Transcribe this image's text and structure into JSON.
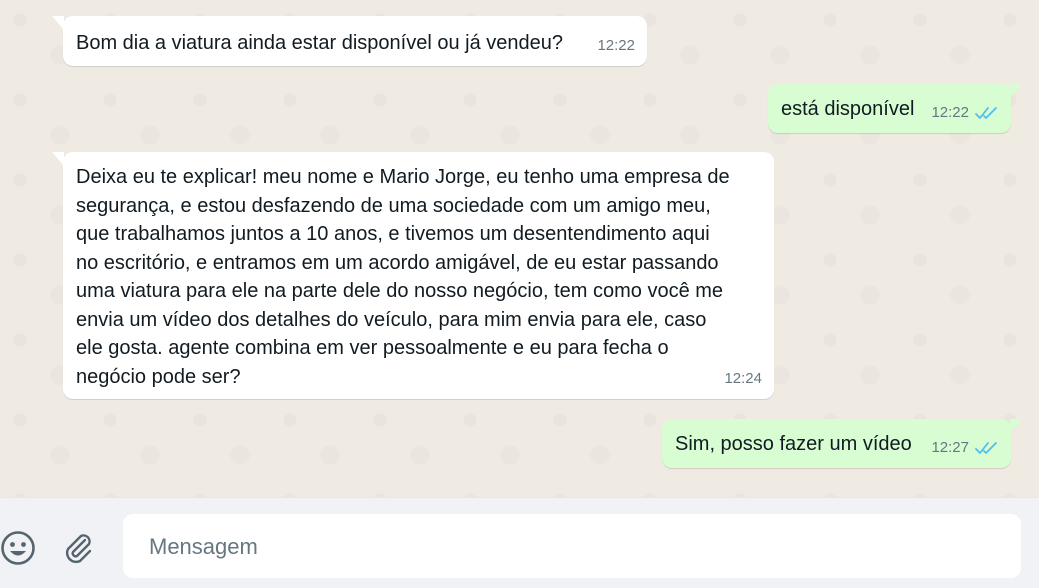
{
  "messages": [
    {
      "direction": "incoming",
      "text": "Bom dia a viatura ainda estar disponível ou já vendeu?",
      "time": "12:22"
    },
    {
      "direction": "outgoing",
      "text": "está disponível",
      "time": "12:22",
      "status": "read"
    },
    {
      "direction": "incoming",
      "text": "Deixa eu te explicar! meu nome e Mario Jorge, eu tenho uma empresa de\nsegurança, e estou desfazendo de uma sociedade com um amigo meu,\nque trabalhamos juntos a 10 anos, e tivemos um desentendimento aqui\nno escritório, e entramos em um acordo amigável, de eu estar passando\numa viatura para ele na parte dele do nosso negócio, tem como você me\nenvia um vídeo dos detalhes do veículo, para mim envia para ele, caso\nele gosta. agente combina em ver pessoalmente e eu para fecha o\nnegócio pode ser?",
      "time": "12:24"
    },
    {
      "direction": "outgoing",
      "text": "Sim, posso fazer um vídeo",
      "time": "12:27",
      "status": "read"
    }
  ],
  "composer": {
    "placeholder": "Mensagem",
    "value": "",
    "emoji_icon": "smiley-icon",
    "attach_icon": "paperclip-icon"
  },
  "colors": {
    "chat_background": "#efeae2",
    "incoming_bubble": "#ffffff",
    "outgoing_bubble": "#d9fdd3",
    "read_ticks": "#53bdeb",
    "meta_text": "#667781",
    "composer_background": "#f0f2f5"
  }
}
